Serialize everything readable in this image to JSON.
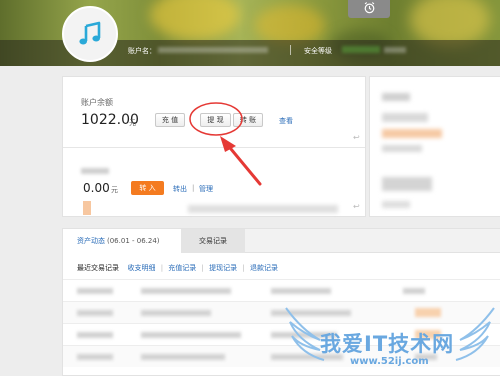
{
  "header": {
    "account_name_label": "账户名：",
    "security_label": "安全等级"
  },
  "balance": {
    "title": "账户余额",
    "amount": "1022.00",
    "unit": "元",
    "buttons": {
      "recharge": "充 值",
      "withdraw": "提 现",
      "transfer": "转 账"
    },
    "view_link": "查看"
  },
  "sub_account": {
    "amount": "0.00",
    "unit": "元",
    "transfer_in": "转 入",
    "transfer_out": "转出",
    "separator": "|",
    "manage": "管理"
  },
  "records": {
    "tabs": {
      "assets": "资产动态",
      "assets_date": "(06.01 - 06.24)",
      "trade": "交易记录"
    },
    "filter": {
      "label": "最近交易记录",
      "links": [
        "收支明细",
        "充值记录",
        "提现记录",
        "退款记录"
      ],
      "separator": "|"
    }
  },
  "icons": {
    "avatar": "music-note-icon",
    "clock": "alarm-clock-icon"
  },
  "colors": {
    "link": "#2a6cb8",
    "accent": "#f47b20",
    "annotation": "#e53935",
    "watermark": "#6aa8e0"
  },
  "watermark": {
    "text": "我爱IT技术网",
    "url": "www.52ij.com"
  }
}
